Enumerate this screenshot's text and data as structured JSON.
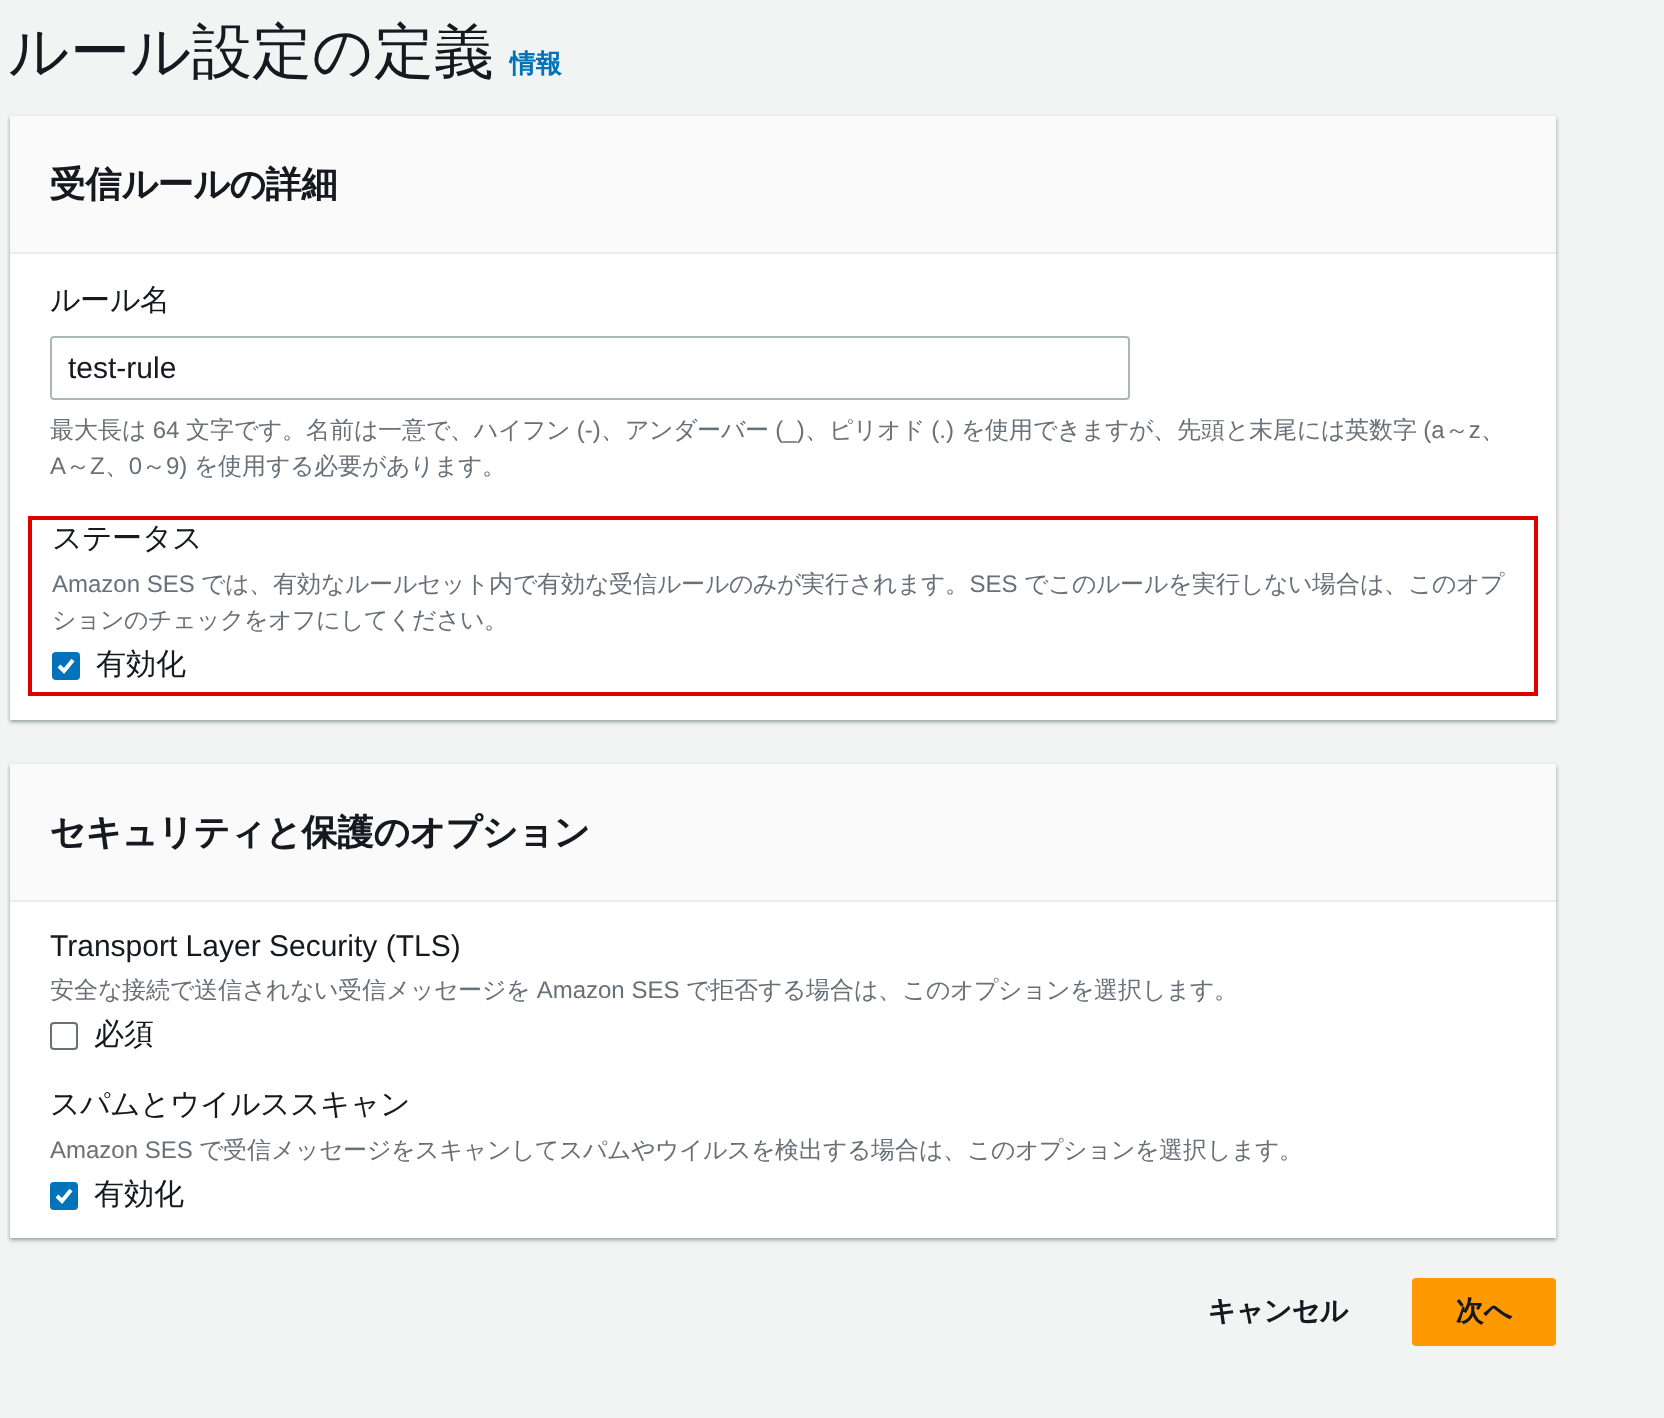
{
  "page": {
    "title": "ルール設定の定義",
    "info_link": "情報"
  },
  "sections": [
    {
      "title": "受信ルールの詳細",
      "fields": [
        {
          "kind": "text",
          "label": "ルール名",
          "value": "test-rule",
          "hint": "最大長は 64 文字です。名前は一意で、ハイフン (-)、アンダーバー (_)、ピリオド (.) を使用できますが、先頭と末尾には英数字 (a～z、A～Z、0～9) を使用する必要があります。",
          "highlighted": false
        },
        {
          "kind": "checkbox",
          "label": "ステータス",
          "hint": "Amazon SES では、有効なルールセット内で有効な受信ルールのみが実行されます。SES でこのルールを実行しない場合は、このオプションのチェックをオフにしてください。",
          "option": "有効化",
          "checked": true,
          "highlighted": true
        }
      ]
    },
    {
      "title": "セキュリティと保護のオプション",
      "fields": [
        {
          "kind": "checkbox",
          "label": "Transport Layer Security (TLS)",
          "hint": "安全な接続で送信されない受信メッセージを Amazon SES で拒否する場合は、このオプションを選択します。",
          "option": "必須",
          "checked": false,
          "highlighted": false
        },
        {
          "kind": "checkbox",
          "label": "スパムとウイルススキャン",
          "hint": "Amazon SES で受信メッセージをスキャンしてスパムやウイルスを検出する場合は、このオプションを選択します。",
          "option": "有効化",
          "checked": true,
          "highlighted": false
        }
      ]
    }
  ],
  "buttons": [
    {
      "kind": "link",
      "label": "キャンセル"
    },
    {
      "kind": "primary",
      "label": "次へ"
    }
  ]
}
